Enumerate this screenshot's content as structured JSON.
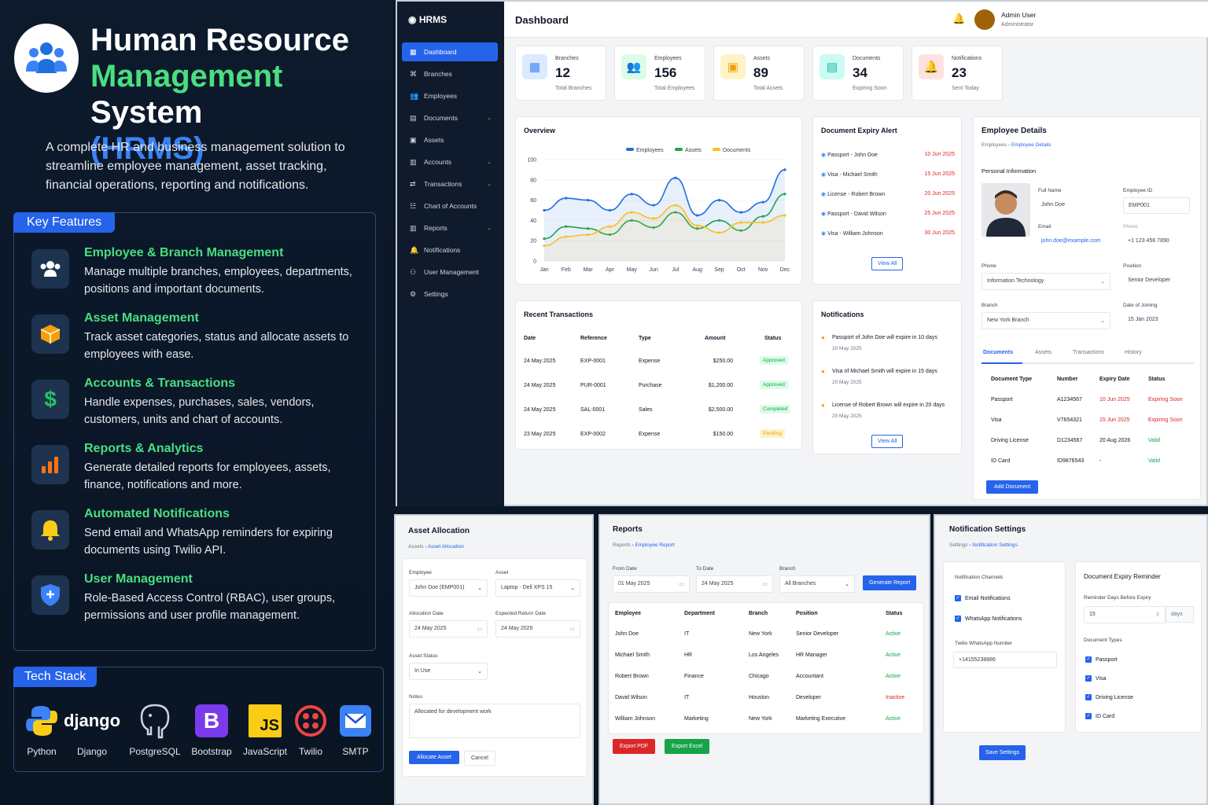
{
  "hero": {
    "title_line1": "Human Resource",
    "title_green": "Management",
    "title_white": " System",
    "title_abbr": "(HRMS)",
    "intro": "A complete HR and business management solution to streamline employee management, asset tracking, financial operations, reporting and notifications."
  },
  "key_features": {
    "label": "Key Features",
    "items": [
      {
        "title": "Employee & Branch Management",
        "desc": "Manage multiple branches, employees, departments, positions and important documents.",
        "icon": "users-icon",
        "color": "#3b82f6"
      },
      {
        "title": "Asset Management",
        "desc": "Track asset categories, status and allocate assets to employees with ease.",
        "icon": "box-icon",
        "color": "#f59e0b"
      },
      {
        "title": "Accounts & Transactions",
        "desc": "Handle expenses, purchases, sales, vendors, customers, units and chart of accounts.",
        "icon": "dollar-icon",
        "color": "#22c55e"
      },
      {
        "title": "Reports & Analytics",
        "desc": "Generate detailed reports for employees, assets, finance, notifications and more.",
        "icon": "bar-chart-icon",
        "color": "#f97316"
      },
      {
        "title": "Automated Notifications",
        "desc": "Send email and WhatsApp reminders for expiring documents using Twilio API.",
        "icon": "bell-icon",
        "color": "#facc15"
      },
      {
        "title": "User Management",
        "desc": "Role-Based Access Control (RBAC), user groups, permissions and user profile management.",
        "icon": "shield-icon",
        "color": "#3b82f6"
      }
    ]
  },
  "tech_stack": {
    "label": "Tech Stack",
    "items": [
      "Python",
      "Django",
      "PostgreSQL",
      "Bootstrap",
      "JavaScript",
      "Twilio",
      "SMTP"
    ],
    "django_wordmark": "django",
    "bootstrap_glyph": "B",
    "js_glyph": "JS"
  },
  "app": {
    "brand": "HRMS",
    "nav": [
      {
        "label": "Dashboard",
        "icon": "dashboard-icon",
        "active": true,
        "chev": false
      },
      {
        "label": "Branches",
        "icon": "branch-icon",
        "chev": false
      },
      {
        "label": "Employees",
        "icon": "users-icon",
        "chev": false
      },
      {
        "label": "Documents",
        "icon": "document-icon",
        "chev": true
      },
      {
        "label": "Assets",
        "icon": "box-icon",
        "chev": false
      },
      {
        "label": "Accounts",
        "icon": "wallet-icon",
        "chev": true
      },
      {
        "label": "Transactions",
        "icon": "transfer-icon",
        "chev": true
      },
      {
        "label": "Chart of Accounts",
        "icon": "tree-icon",
        "chev": false
      },
      {
        "label": "Reports",
        "icon": "bar-chart-icon",
        "chev": true
      },
      {
        "label": "Notifications",
        "icon": "bell-icon",
        "chev": false
      },
      {
        "label": "User Management",
        "icon": "user-cog-icon",
        "chev": false
      },
      {
        "label": "Settings",
        "icon": "gear-icon",
        "chev": false
      }
    ],
    "page_title": "Dashboard",
    "user_name": "Admin User",
    "user_role": "Administrator",
    "stats": [
      {
        "label": "Branches",
        "value": "12",
        "sub": "Total Branches",
        "color": "#3b82f6",
        "bg": "#dbeafe"
      },
      {
        "label": "Employees",
        "value": "156",
        "sub": "Total Employees",
        "color": "#16a34a",
        "bg": "#dcfce7"
      },
      {
        "label": "Assets",
        "value": "89",
        "sub": "Total Assets",
        "color": "#f59e0b",
        "bg": "#fef3c7"
      },
      {
        "label": "Documents",
        "value": "34",
        "sub": "Expiring Soon",
        "color": "#14b8a6",
        "bg": "#ccfbf1"
      },
      {
        "label": "Notifications",
        "value": "23",
        "sub": "Sent Today",
        "color": "#ef4444",
        "bg": "#fee2e2"
      }
    ],
    "expiry": {
      "title": "Document Expiry Alert",
      "items": [
        {
          "name": "Passport - John Doe",
          "date": "10 Jun 2025"
        },
        {
          "name": "Visa - Michael Smith",
          "date": "15 Jun 2025"
        },
        {
          "name": "License - Robert Brown",
          "date": "20 Jun 2025"
        },
        {
          "name": "Passport - David Wilson",
          "date": "25 Jun 2025"
        },
        {
          "name": "Visa - William Johnson",
          "date": "30 Jun 2025"
        }
      ],
      "view_all": "View All"
    },
    "transactions": {
      "title": "Recent Transactions",
      "headers": [
        "Date",
        "Reference",
        "Type",
        "Amount",
        "Status"
      ],
      "rows": [
        [
          "24 May 2025",
          "EXP-0001",
          "Expense",
          "$250.00",
          "Approved"
        ],
        [
          "24 May 2025",
          "PUR-0001",
          "Purchase",
          "$1,200.00",
          "Approved"
        ],
        [
          "24 May 2025",
          "SAL-0001",
          "Sales",
          "$2,500.00",
          "Completed"
        ],
        [
          "23 May 2025",
          "EXP-0002",
          "Expense",
          "$150.00",
          "Pending"
        ]
      ]
    },
    "notifications": {
      "title": "Notifications",
      "items": [
        {
          "text": "Passport of John Doe will expire in 10 days",
          "date": "20 May 2025"
        },
        {
          "text": "Visa of Michael Smith will expire in 15 days",
          "date": "20 May 2025"
        },
        {
          "text": "License of Robert Brown will expire in 20 days",
          "date": "20 May 2025"
        }
      ],
      "view_all": "View All"
    },
    "employee": {
      "title": "Employee Details",
      "crumb1": "Employees",
      "crumb2": "Employee Details",
      "section": "Personal Information",
      "full_name_label": "Full Name",
      "full_name": "John Doe",
      "emp_id_label": "Employee ID",
      "emp_id": "EMP001",
      "email_label": "Email",
      "email": "john.doe@example.com",
      "phone_label_top": "Phone",
      "phone": "+1 123 456 7890",
      "phone_label": "Phone",
      "dept": "Information Technology",
      "position_label": "Position",
      "position": "Senior Developer",
      "branch_label": "Branch",
      "branch": "New York Branch",
      "doj_label": "Date of Joining",
      "doj": "15 Jan 2023",
      "tabs": [
        "Documents",
        "Assets",
        "Transactions",
        "History"
      ],
      "doc_headers": [
        "Document Type",
        "Number",
        "Expiry Date",
        "Status"
      ],
      "docs": [
        [
          "Passport",
          "A1234567",
          "10 Jun 2025",
          "Expiring Soon"
        ],
        [
          "Visa",
          "V7654321",
          "15 Jun 2025",
          "Expiring Soon"
        ],
        [
          "Driving License",
          "D1234567",
          "20 Aug 2026",
          "Valid"
        ],
        [
          "ID Card",
          "ID9876543",
          "-",
          "Valid"
        ]
      ],
      "add_button": "Add Document"
    }
  },
  "chart_data": {
    "type": "line",
    "title": "Overview",
    "categories": [
      "Jan",
      "Feb",
      "Mar",
      "Apr",
      "May",
      "Jun",
      "Jul",
      "Aug",
      "Sep",
      "Oct",
      "Nov",
      "Dec"
    ],
    "ylim": [
      0,
      100
    ],
    "yticks": [
      0,
      20,
      40,
      60,
      80,
      100
    ],
    "legend": "top-center",
    "series": [
      {
        "name": "Employees",
        "color": "#1d6fe0",
        "values": [
          50,
          62,
          60,
          50,
          66,
          55,
          82,
          45,
          60,
          48,
          58,
          90
        ]
      },
      {
        "name": "Assets",
        "color": "#22a34a",
        "values": [
          22,
          34,
          32,
          26,
          40,
          33,
          48,
          32,
          40,
          30,
          44,
          66
        ]
      },
      {
        "name": "Documents",
        "color": "#fbbf24",
        "values": [
          15,
          24,
          26,
          34,
          48,
          42,
          55,
          35,
          28,
          38,
          38,
          45
        ]
      }
    ]
  },
  "asset_allocation": {
    "title": "Asset Allocation",
    "crumb1": "Assets",
    "crumb2": "Asset Allocation",
    "employee_label": "Employee",
    "employee": "John Doe (EMP001)",
    "asset_label": "Asset",
    "asset": "Laptop - Dell XPS 15",
    "alloc_date_label": "Allocation Date",
    "alloc_date": "24 May 2025",
    "return_label": "Expected Return Date",
    "return_date": "24 May 2026",
    "status_label": "Asset Status",
    "status": "In Use",
    "notes_label": "Notes",
    "notes": "Allocated for development work",
    "allocate_button": "Allocate Asset",
    "cancel_button": "Cancel"
  },
  "reports": {
    "title": "Reports",
    "crumb1": "Reports",
    "crumb2": "Employee Report",
    "from_label": "From Date",
    "from": "01 May 2025",
    "to_label": "To Date",
    "to": "24 May 2025",
    "branch_label": "Branch",
    "branch": "All Branches",
    "generate_button": "Generate Report",
    "headers": [
      "Employee",
      "Department",
      "Branch",
      "Position",
      "Status"
    ],
    "rows": [
      [
        "John Doe",
        "IT",
        "New York",
        "Senior Developer",
        "Active"
      ],
      [
        "Michael Smith",
        "HR",
        "Los Angeles",
        "HR Manager",
        "Active"
      ],
      [
        "Robert Brown",
        "Finance",
        "Chicago",
        "Accountant",
        "Active"
      ],
      [
        "David Wilson",
        "IT",
        "Houston",
        "Developer",
        "Inactive"
      ],
      [
        "William Johnson",
        "Marketing",
        "New York",
        "Marketing Executive",
        "Active"
      ]
    ],
    "pdf_button": "Export PDF",
    "excel_button": "Export Excel"
  },
  "notif_settings": {
    "title": "Notification Settings",
    "crumb1": "Settings",
    "crumb2": "Notification Settings",
    "channels_label": "Notification Channels",
    "email": "Email Notifications",
    "whatsapp": "WhatsApp Notifications",
    "twilio_label": "Twilio WhatsApp Number",
    "twilio": "+14155238886",
    "reminder_title": "Document Expiry Reminder",
    "days_label": "Reminder Days Before Expiry",
    "days": "15",
    "days_unit": "days",
    "types_label": "Document Types",
    "types": [
      "Passport",
      "Visa",
      "Driving License",
      "ID Card"
    ],
    "save_button": "Save Settings"
  }
}
